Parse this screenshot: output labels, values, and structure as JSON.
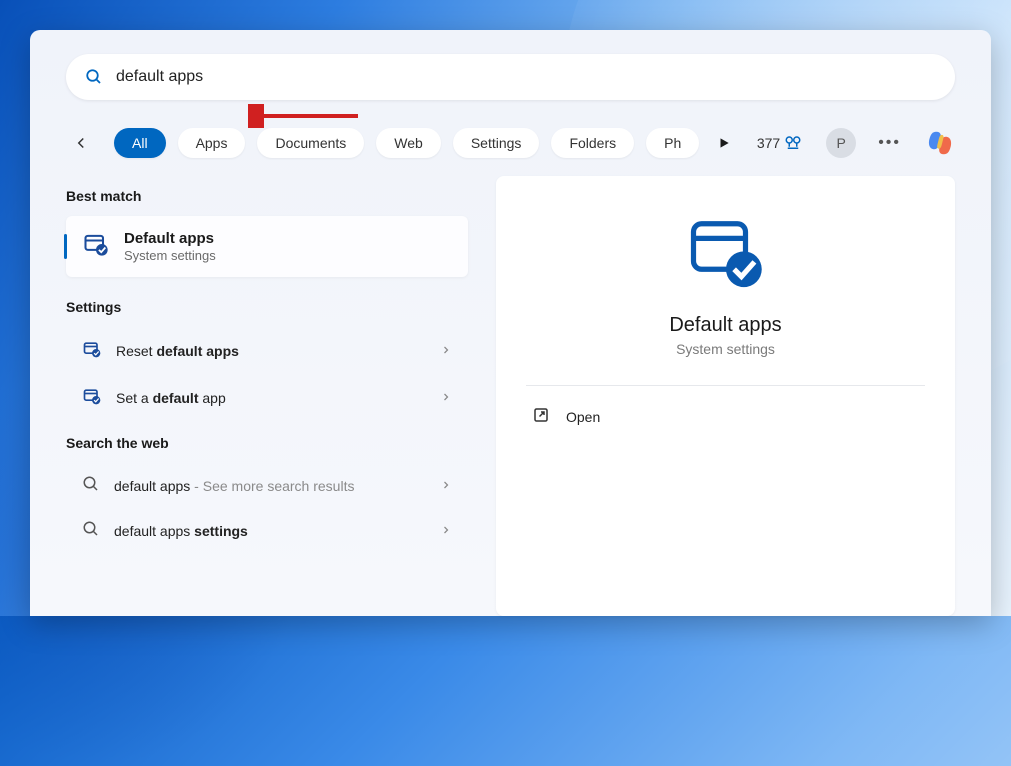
{
  "search": {
    "query": "default apps"
  },
  "filters": {
    "all": "All",
    "apps": "Apps",
    "documents": "Documents",
    "web": "Web",
    "settings": "Settings",
    "folders": "Folders",
    "photos_truncated": "Ph"
  },
  "header": {
    "points": "377",
    "avatar_initial": "P"
  },
  "sections": {
    "best_match": "Best match",
    "settings": "Settings",
    "search_web": "Search the web"
  },
  "best_match": {
    "title": "Default apps",
    "subtitle": "System settings"
  },
  "settings_results": [
    {
      "prefix": "Reset ",
      "bold": "default apps",
      "suffix": ""
    },
    {
      "prefix": "Set a ",
      "bold": "default",
      "suffix": " app"
    }
  ],
  "web_results": [
    {
      "main": "default apps",
      "hint": " - See more search results"
    },
    {
      "main_prefix": "default apps ",
      "bold": "settings",
      "hint": ""
    }
  ],
  "detail": {
    "title": "Default apps",
    "subtitle": "System settings",
    "open_label": "Open"
  }
}
